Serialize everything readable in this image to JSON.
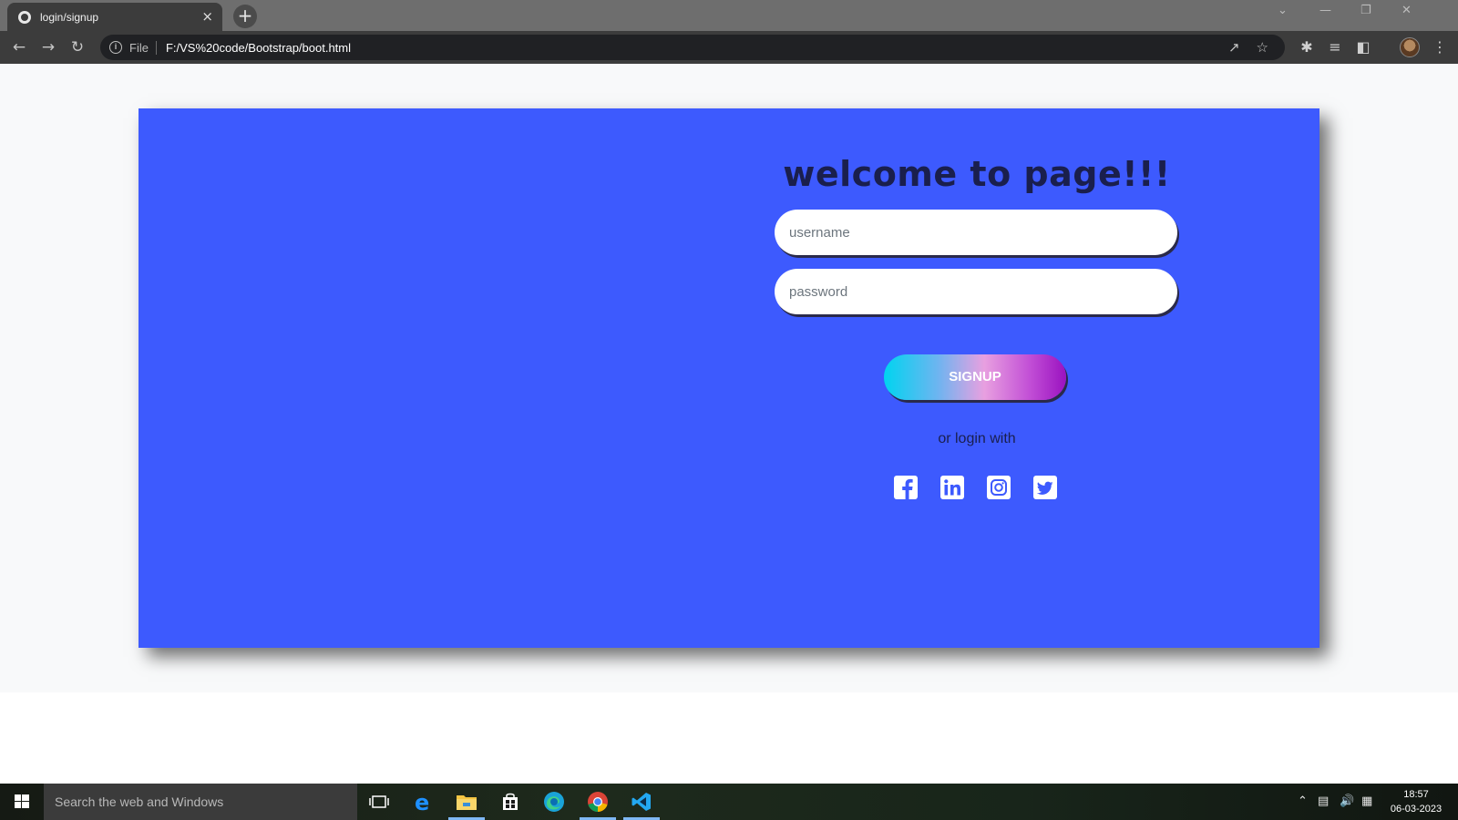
{
  "browser": {
    "tab_title": "login/signup",
    "tab_close": "×",
    "new_tab": "+",
    "url_scheme": "File",
    "url": "F:/VS%20code/Bootstrap/boot.html"
  },
  "page": {
    "heading": "welcome to page!!!",
    "username_placeholder": "username",
    "password_placeholder": "password",
    "signup_label": "SIGNUP",
    "or_login_text": "or login with",
    "socials": [
      "facebook",
      "linkedin",
      "instagram",
      "twitter"
    ],
    "card_color": "#3d5afe",
    "heading_color": "#1a1f4d"
  },
  "taskbar": {
    "search_placeholder": "Search the web and Windows",
    "time": "18:57",
    "date": "06-03-2023"
  }
}
